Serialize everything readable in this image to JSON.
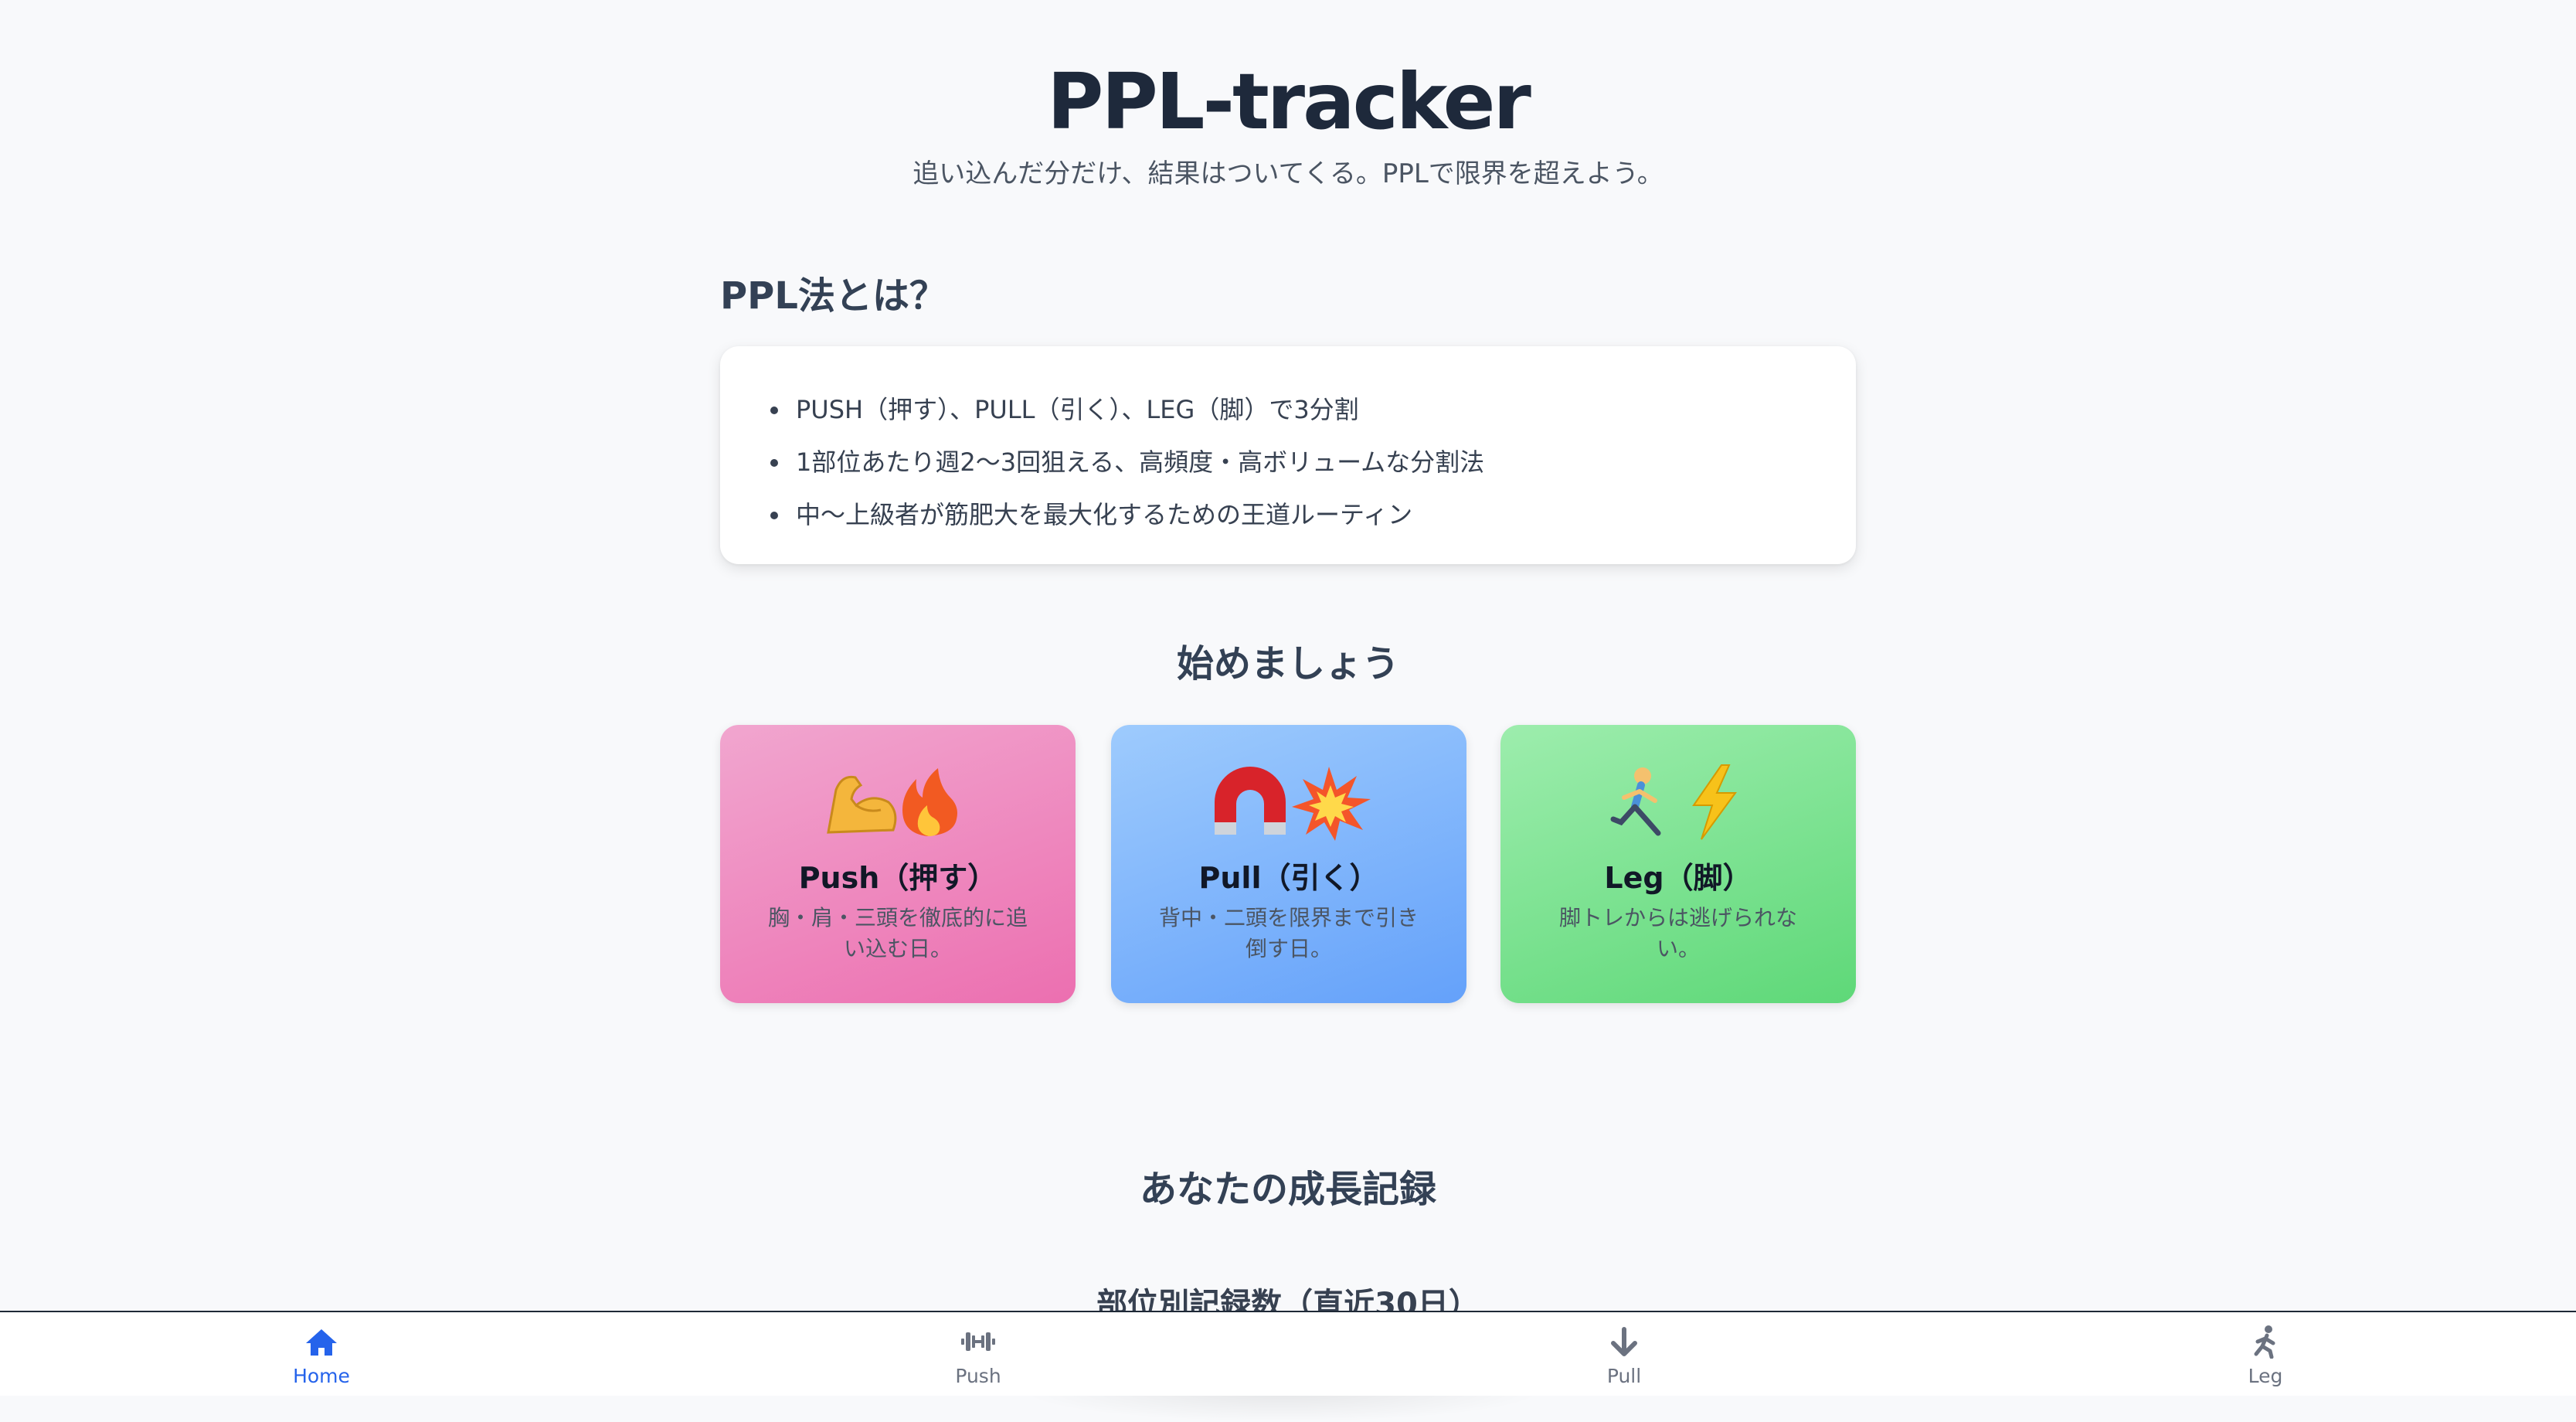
{
  "header": {
    "title": "PPL-tracker",
    "subtitle": "追い込んだ分だけ、結果はついてくる。PPLで限界を超えよう。"
  },
  "about": {
    "heading": "PPL法とは？",
    "items": [
      "PUSH（押す）、PULL（引く）、LEG（脚）で3分割",
      "1部位あたり週2〜3回狙える、高頻度・高ボリュームな分割法",
      "中〜上級者が筋肥大を最大化するための王道ルーティン"
    ]
  },
  "start": {
    "heading": "始めましょう",
    "cards": [
      {
        "title": "Push（押す）",
        "desc": "胸・肩・三頭を徹底的に追い込む日。",
        "icons": [
          "flexed-biceps-icon",
          "fire-icon"
        ],
        "color_from": "#f1a6cf",
        "color_to": "#ec6fb0"
      },
      {
        "title": "Pull（引く）",
        "desc": "背中・二頭を限界まで引き倒す日。",
        "icons": [
          "magnet-icon",
          "collision-icon"
        ],
        "color_from": "#9ecbfd",
        "color_to": "#64a1fa"
      },
      {
        "title": "Leg（脚）",
        "desc": "脚トレからは逃げられない。",
        "icons": [
          "running-person-icon",
          "lightning-icon"
        ],
        "color_from": "#9dedad",
        "color_to": "#5ed878"
      }
    ]
  },
  "growth": {
    "heading": "あなたの成長記録",
    "subheading": "部位別記録数（直近30日）"
  },
  "nav": {
    "active": "Home",
    "accent": "#2563eb",
    "items": [
      {
        "label": "Home",
        "icon": "home-icon"
      },
      {
        "label": "Push",
        "icon": "dumbbell-icon"
      },
      {
        "label": "Pull",
        "icon": "arrow-down-icon"
      },
      {
        "label": "Leg",
        "icon": "running-icon"
      }
    ]
  }
}
